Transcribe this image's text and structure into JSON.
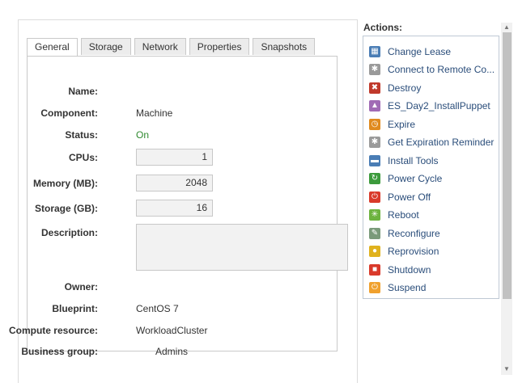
{
  "tabs": [
    "General",
    "Storage",
    "Network",
    "Properties",
    "Snapshots"
  ],
  "fields": {
    "name_label": "Name:",
    "component_label": "Component:",
    "component_value": "Machine",
    "status_label": "Status:",
    "status_value": "On",
    "cpus_label": "CPUs:",
    "cpus_value": "1",
    "memory_label": "Memory (MB):",
    "memory_value": "2048",
    "storage_label": "Storage (GB):",
    "storage_value": "16",
    "description_label": "Description:",
    "owner_label": "Owner:",
    "blueprint_label": "Blueprint:",
    "blueprint_value": "CentOS 7",
    "compute_label": "Compute resource:",
    "compute_value": "WorkloadCluster",
    "business_label": "Business group:",
    "business_value": "Admins"
  },
  "actions_title": "Actions:",
  "actions": [
    {
      "label": "Change Lease",
      "icon": "calendar-icon",
      "color": "#4a7db5"
    },
    {
      "label": "Connect to Remote Co...",
      "icon": "gear-icon",
      "color": "#9a9a9a"
    },
    {
      "label": "Destroy",
      "icon": "trash-icon",
      "color": "#c0392b"
    },
    {
      "label": "ES_Day2_InstallPuppet",
      "icon": "flask-icon",
      "color": "#a06bb5"
    },
    {
      "label": "Expire",
      "icon": "clock-icon",
      "color": "#e08a1e"
    },
    {
      "label": "Get Expiration Reminder",
      "icon": "gear-icon",
      "color": "#9a9a9a"
    },
    {
      "label": "Install Tools",
      "icon": "tools-icon",
      "color": "#4a7db5"
    },
    {
      "label": "Power Cycle",
      "icon": "cycle-icon",
      "color": "#3c9a3c"
    },
    {
      "label": "Power Off",
      "icon": "power-icon",
      "color": "#d93a2b"
    },
    {
      "label": "Reboot",
      "icon": "reboot-icon",
      "color": "#6db33f"
    },
    {
      "label": "Reconfigure",
      "icon": "reconfigure-icon",
      "color": "#7a9a7a"
    },
    {
      "label": "Reprovision",
      "icon": "reprovision-icon",
      "color": "#e0b21e"
    },
    {
      "label": "Shutdown",
      "icon": "stop-icon",
      "color": "#d93a2b"
    },
    {
      "label": "Suspend",
      "icon": "suspend-icon",
      "color": "#f0a12e"
    }
  ]
}
